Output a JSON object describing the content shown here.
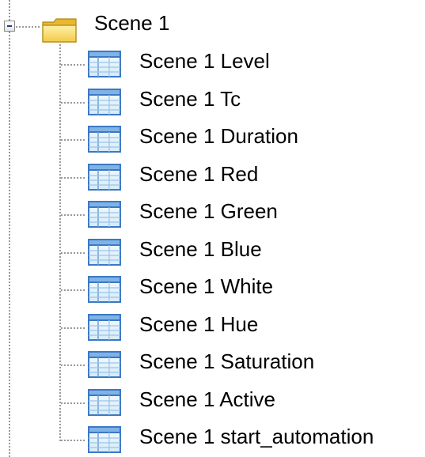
{
  "tree": {
    "root": {
      "label": "Scene 1",
      "icon": "folder-icon",
      "expanded": true
    },
    "children": [
      {
        "label": "Scene 1 Level",
        "icon": "table-icon"
      },
      {
        "label": "Scene 1 Tc",
        "icon": "table-icon"
      },
      {
        "label": "Scene 1 Duration",
        "icon": "table-icon"
      },
      {
        "label": "Scene 1 Red",
        "icon": "table-icon"
      },
      {
        "label": "Scene 1 Green",
        "icon": "table-icon"
      },
      {
        "label": "Scene 1 Blue",
        "icon": "table-icon"
      },
      {
        "label": "Scene 1 White",
        "icon": "table-icon"
      },
      {
        "label": "Scene 1 Hue",
        "icon": "table-icon"
      },
      {
        "label": "Scene 1 Saturation",
        "icon": "table-icon"
      },
      {
        "label": "Scene 1 Active",
        "icon": "table-icon"
      },
      {
        "label": "Scene 1 start_automation",
        "icon": "table-icon"
      }
    ]
  }
}
